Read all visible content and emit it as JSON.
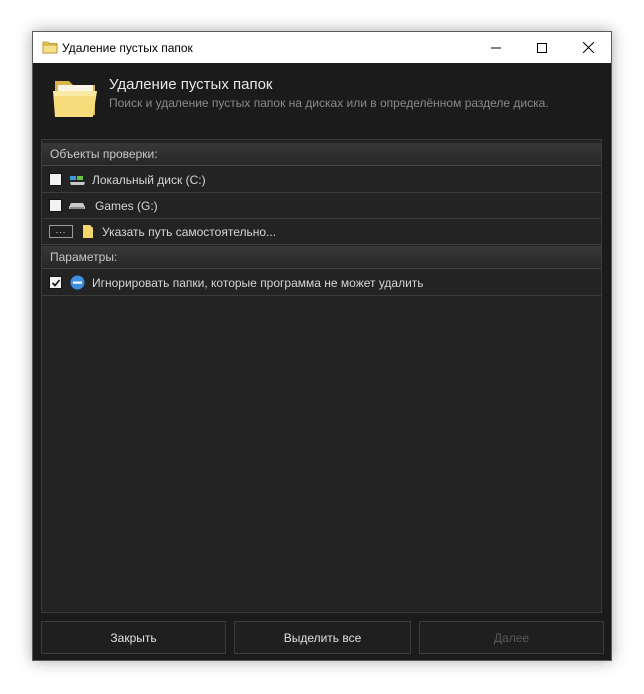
{
  "window": {
    "title": "Удаление пустых папок",
    "icon": "folder-icon",
    "controls": [
      "minimize-icon",
      "maximize-icon",
      "close-icon"
    ]
  },
  "header": {
    "title": "Удаление пустых папок",
    "subtitle": "Поиск и удаление пустых папок на дисках или в определённом разделе диска.",
    "icon": "folder-icon"
  },
  "sections": {
    "objects_label": "Объекты проверки:",
    "params_label": "Параметры:"
  },
  "objects": [
    {
      "label": "Локальный диск (C:)",
      "checked": false,
      "icon": "system-drive-icon"
    },
    {
      "label": "Games (G:)",
      "checked": false,
      "icon": "drive-icon"
    }
  ],
  "custom_path": {
    "button_label": "...",
    "label": "Указать путь самостоятельно...",
    "icon": "folder-icon"
  },
  "params": [
    {
      "label": "Игнорировать папки, которые программа не может удалить",
      "checked": true,
      "icon": "info-icon"
    }
  ],
  "footer": {
    "close_label": "Закрыть",
    "select_all_label": "Выделить все",
    "next_label": "Далее",
    "next_enabled": false
  },
  "colors": {
    "window_bg": "#1b1b1b",
    "panel_bg": "#232323",
    "text": "#d6d6d6",
    "folder_yellow": "#f2d66b",
    "accent_blue": "#3d8fe0"
  }
}
